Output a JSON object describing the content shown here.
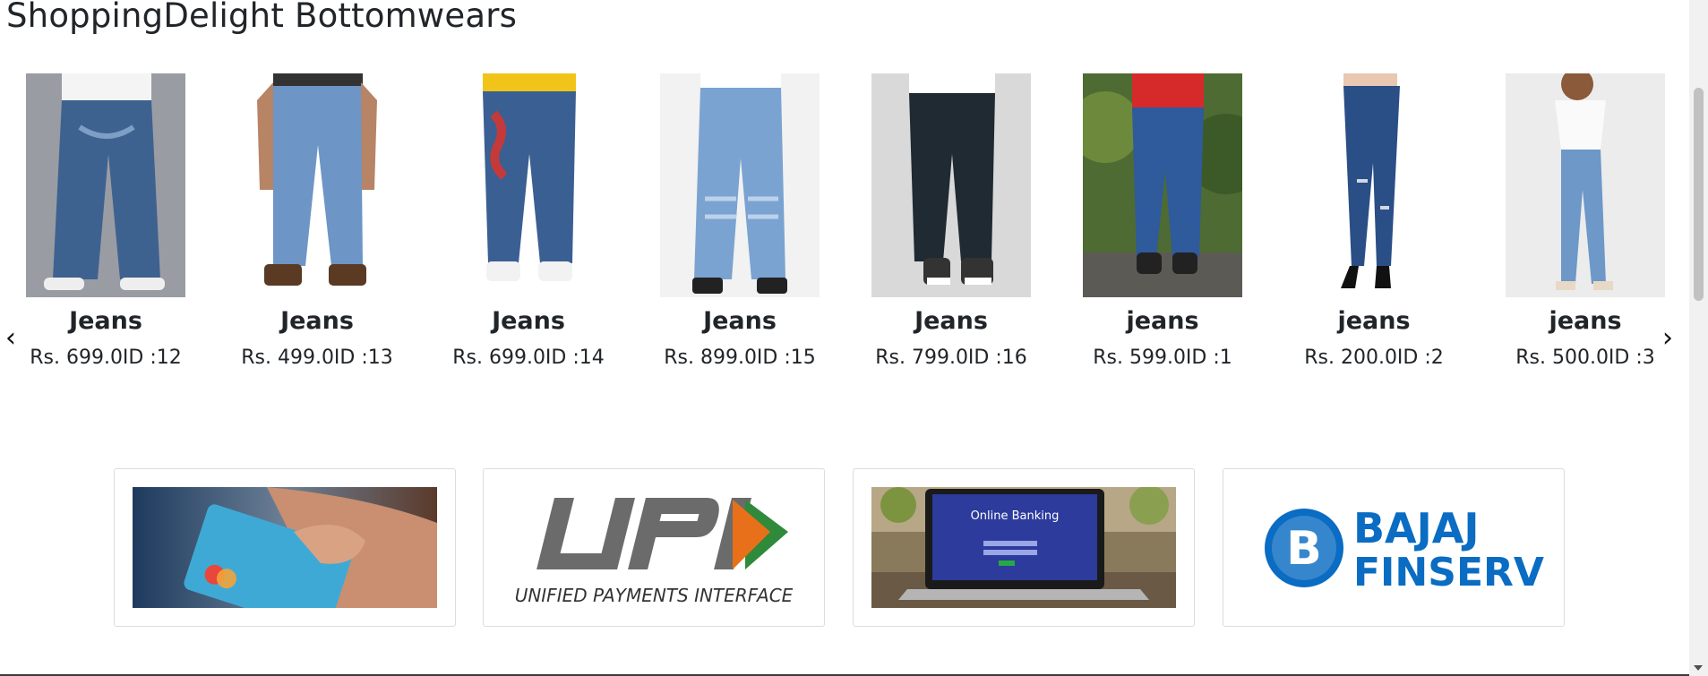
{
  "section": {
    "title": "ShoppingDelight Bottomwears"
  },
  "carousel": {
    "prev_label": "‹",
    "next_label": "›",
    "products": [
      {
        "name": "Jeans",
        "price": "Rs. 699.0ID :12"
      },
      {
        "name": "Jeans",
        "price": "Rs. 499.0ID :13"
      },
      {
        "name": "Jeans",
        "price": "Rs. 699.0ID :14"
      },
      {
        "name": "Jeans",
        "price": "Rs. 899.0ID :15"
      },
      {
        "name": "Jeans",
        "price": "Rs. 799.0ID :16"
      },
      {
        "name": "jeans",
        "price": "Rs. 599.0ID :1"
      },
      {
        "name": "jeans",
        "price": "Rs. 200.0ID :2"
      },
      {
        "name": "jeans",
        "price": "Rs. 500.0ID :3"
      }
    ]
  },
  "payments": {
    "upi": {
      "brand": "UPI",
      "caption": "UNIFIED PAYMENTS INTERFACE"
    },
    "netbanking": {
      "screen_title": "Online Banking"
    },
    "bajaj": {
      "line1": "BAJAJ",
      "line2": "FINSERV"
    }
  },
  "colors": {
    "upi_grey": "#6b6b6b",
    "upi_orange": "#e8701a",
    "upi_green": "#2f8a3b",
    "bajaj_blue": "#0a6cc2",
    "denim": "#3e6aa3"
  }
}
